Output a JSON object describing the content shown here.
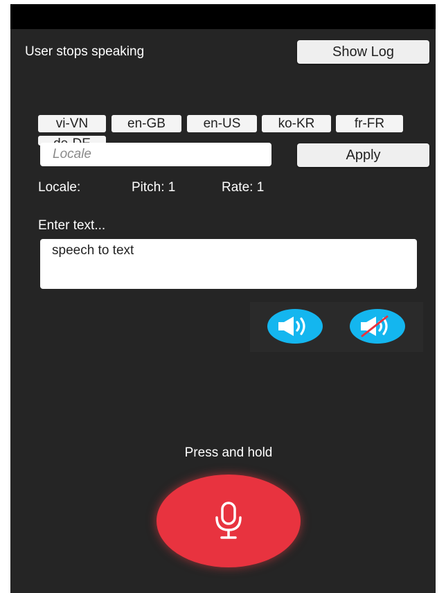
{
  "status": {
    "text": "User stops speaking"
  },
  "toolbar": {
    "show_log_label": "Show Log"
  },
  "locales": {
    "chips": [
      "vi-VN",
      "en-GB",
      "en-US",
      "ko-KR",
      "fr-FR",
      "de-DE"
    ]
  },
  "locale_input": {
    "placeholder": "Locale",
    "value": ""
  },
  "apply": {
    "label": "Apply"
  },
  "settings": {
    "locale_label": "Locale:",
    "pitch_label": "Pitch: 1",
    "rate_label": "Rate: 1"
  },
  "text_entry": {
    "label": "Enter text...",
    "value": "speech to text"
  },
  "speaker": {
    "speak_icon": "speaker-icon",
    "stop_icon": "speaker-muted-icon"
  },
  "record": {
    "label": "Press and hold",
    "icon": "microphone-icon"
  },
  "colors": {
    "background": "#252525",
    "top_bar": "#000000",
    "speaker_accent": "#14b6ef",
    "mic_button": "#e8333f",
    "button_bg": "#efefef"
  }
}
